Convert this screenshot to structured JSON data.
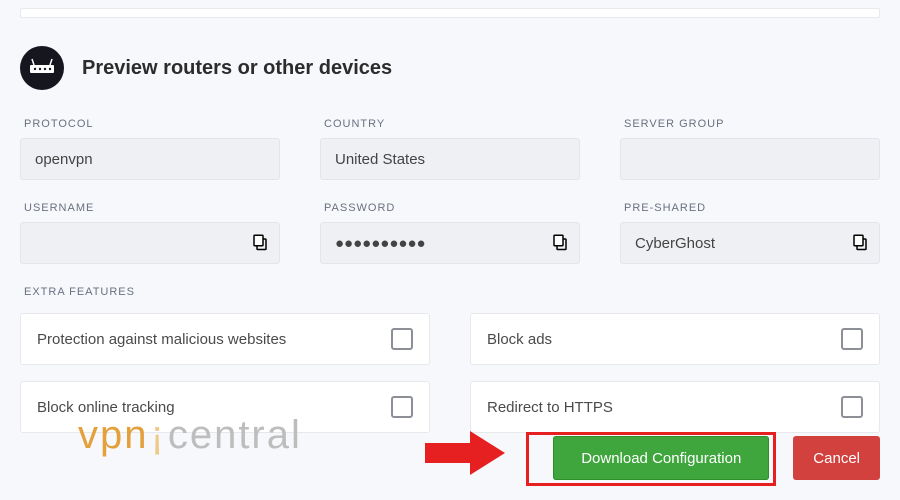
{
  "header": {
    "title": "Preview routers or other devices"
  },
  "fields": {
    "protocol": {
      "label": "PROTOCOL",
      "value": "openvpn"
    },
    "country": {
      "label": "COUNTRY",
      "value": "United States"
    },
    "server_group": {
      "label": "SERVER GROUP",
      "value": ""
    },
    "username": {
      "label": "USERNAME",
      "value": ""
    },
    "password": {
      "label": "PASSWORD",
      "value": "●●●●●●●●●●"
    },
    "preshared": {
      "label": "PRE-SHARED",
      "value": "CyberGhost"
    }
  },
  "extra_features": {
    "label": "EXTRA FEATURES",
    "items": [
      "Protection against malicious websites",
      "Block ads",
      "Block online tracking",
      "Redirect to HTTPS"
    ]
  },
  "buttons": {
    "download": "Download Configuration",
    "cancel": "Cancel"
  },
  "watermark": {
    "vpn": "vpn",
    "central": "central"
  }
}
